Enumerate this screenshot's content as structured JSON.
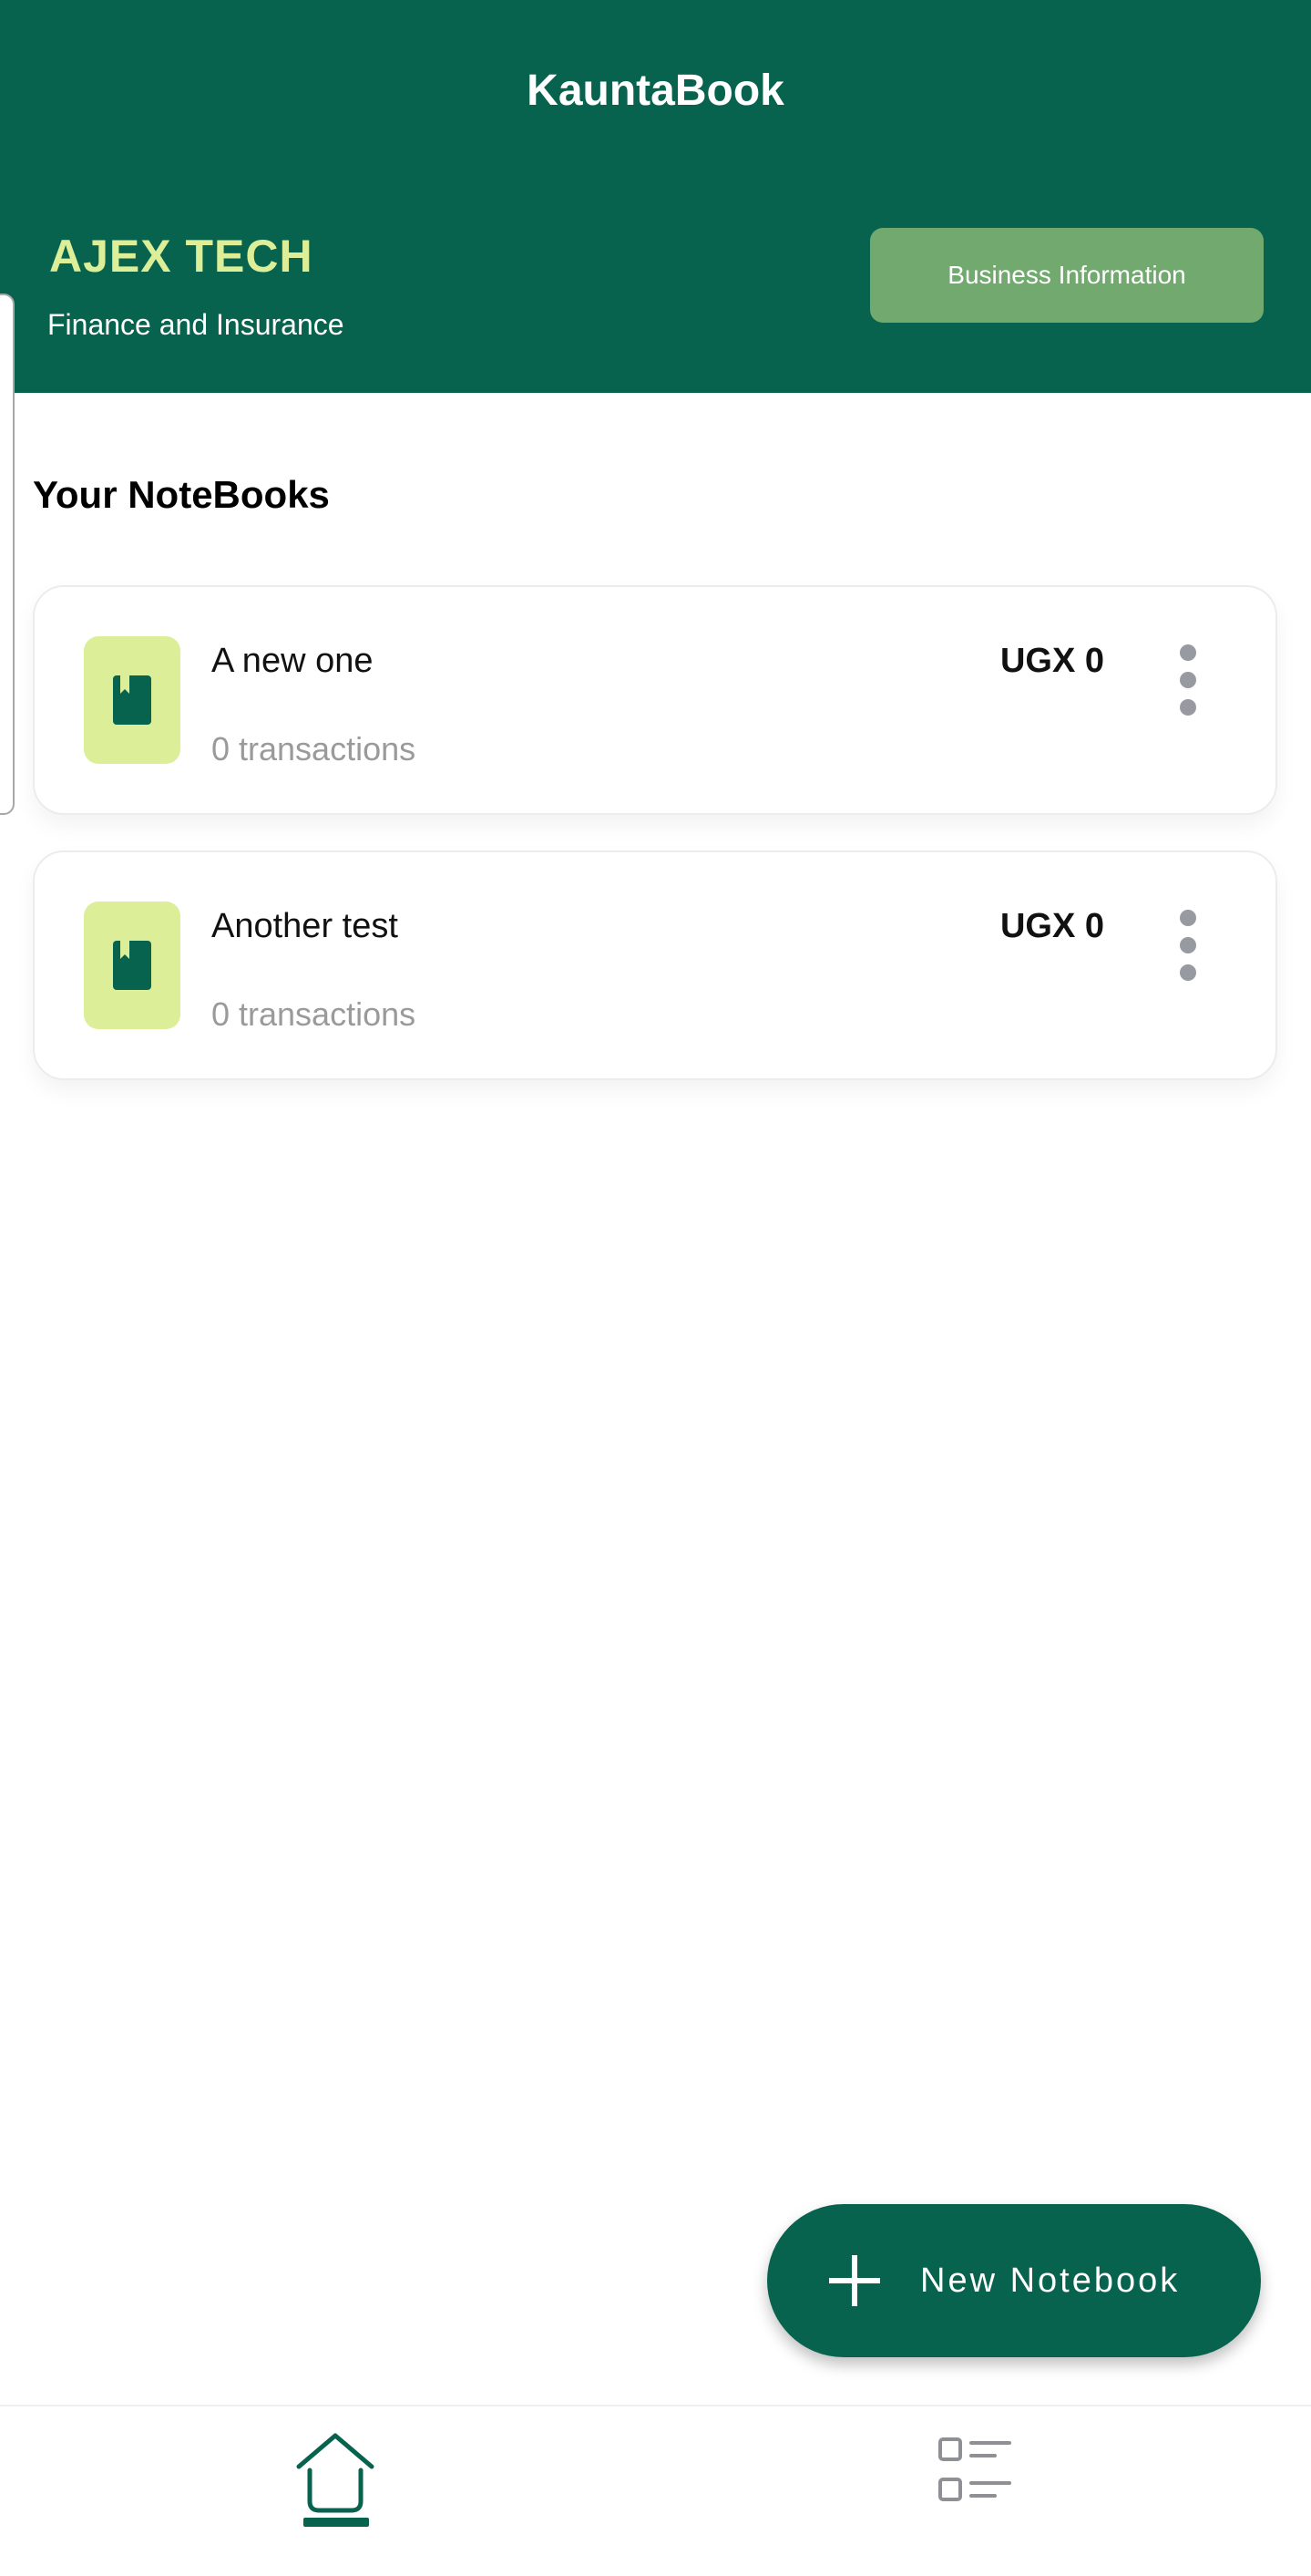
{
  "app": {
    "title": "KauntaBook"
  },
  "business": {
    "name": "AJEX TECH",
    "sector": "Finance and Insurance",
    "info_button_label": "Business Information"
  },
  "section": {
    "title": "Your NoteBooks"
  },
  "notebooks": [
    {
      "name": "A new one",
      "transactions": "0 transactions",
      "amount": "UGX 0"
    },
    {
      "name": "Another test",
      "transactions": "0 transactions",
      "amount": "UGX 0"
    }
  ],
  "fab": {
    "label": "New Notebook",
    "icon": "plus-icon"
  },
  "bottom_nav": {
    "items": [
      {
        "icon": "home-icon",
        "active": true
      },
      {
        "icon": "checklist-icon",
        "active": false
      }
    ]
  },
  "colors": {
    "primary": "#07634e",
    "accent_yellow": "#dcee97",
    "button_green": "#72a96f",
    "icon_box": "#dcef98"
  }
}
